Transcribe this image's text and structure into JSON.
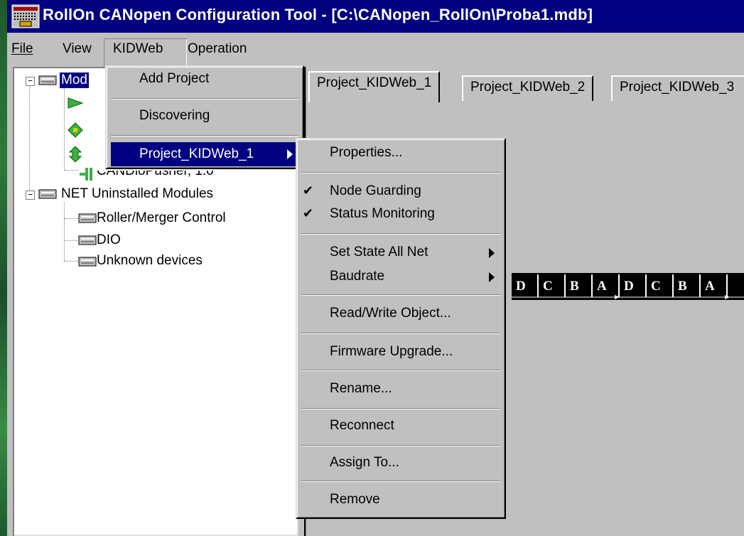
{
  "window": {
    "title": "RollOn CANopen Configuration Tool - [C:\\CANopen_RollOn\\Proba1.mdb]"
  },
  "menubar": {
    "file": "File",
    "view": "View",
    "kidweb": "KIDWeb",
    "operation": "Operation"
  },
  "tree": {
    "root_partial": "Mod",
    "visible_partial_item": "CANDioPusher, 1.0",
    "uninstalled_group": "NET Uninstalled Modules",
    "uninstalled_items": [
      "Roller/Merger Control",
      "DIO",
      "Unknown devices"
    ]
  },
  "tabs": [
    "Project_KIDWeb_1",
    "Project_KIDWeb_2",
    "Project_KIDWeb_3"
  ],
  "kidweb_menu": {
    "items": [
      "Add Project",
      "Discovering",
      "Project_KIDWeb_1"
    ]
  },
  "project_submenu": {
    "items": [
      {
        "label": "Properties...",
        "checked": false,
        "submenu": false
      },
      {
        "label": "Node Guarding",
        "checked": true,
        "submenu": false
      },
      {
        "label": "Status Monitoring",
        "checked": true,
        "submenu": false
      },
      {
        "label": "Set State All Net",
        "checked": false,
        "submenu": true
      },
      {
        "label": "Baudrate",
        "checked": false,
        "submenu": true
      },
      {
        "label": "Read/Write Object...",
        "checked": false,
        "submenu": false
      },
      {
        "label": "Firmware Upgrade...",
        "checked": false,
        "submenu": false
      },
      {
        "label": "Rename...",
        "checked": false,
        "submenu": false
      },
      {
        "label": "Reconnect",
        "checked": false,
        "submenu": false
      },
      {
        "label": "Assign To...",
        "checked": false,
        "submenu": false
      },
      {
        "label": "Remove",
        "checked": false,
        "submenu": false
      }
    ]
  },
  "bus": {
    "labels": [
      "D",
      "C",
      "B",
      "A",
      "D",
      "C",
      "B",
      "A"
    ]
  },
  "colors": {
    "titlebar": "#000080",
    "highlight": "#000080",
    "face": "#c0c0c0",
    "tree_bg": "#ffffff"
  }
}
